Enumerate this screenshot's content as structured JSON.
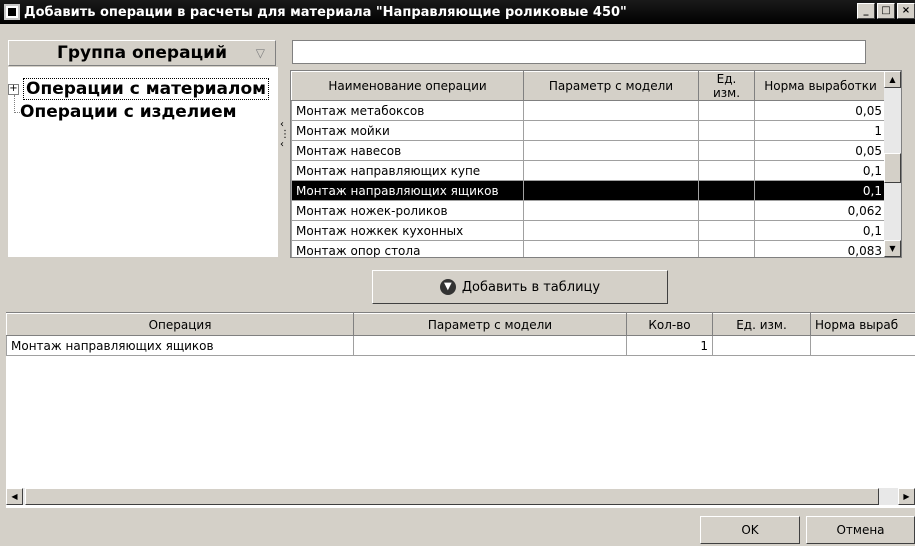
{
  "window": {
    "title": "Добавить операции в расчеты для материала \"Направляющие роликовые 450\"",
    "minimize": "_",
    "maximize": "□",
    "close": "×"
  },
  "groups": {
    "header": "Группа операций",
    "items": [
      {
        "label": "Операции с материалом",
        "expander": "+"
      },
      {
        "label": "Операции с изделием"
      }
    ]
  },
  "search": {
    "value": "",
    "placeholder": ""
  },
  "operations": {
    "columns": [
      "Наименование операции",
      "Параметр с модели",
      "Ед. изм.",
      "Норма выработки"
    ],
    "rows": [
      {
        "name": "Монтаж метабоксов",
        "param": "",
        "unit": "",
        "norm": "0,05"
      },
      {
        "name": "Монтаж мойки",
        "param": "",
        "unit": "",
        "norm": "1"
      },
      {
        "name": "Монтаж навесов",
        "param": "",
        "unit": "",
        "norm": "0,05"
      },
      {
        "name": "Монтаж направляющих купе",
        "param": "",
        "unit": "",
        "norm": "0,1"
      },
      {
        "name": "Монтаж направляющих ящиков",
        "param": "",
        "unit": "",
        "norm": "0,1"
      },
      {
        "name": "Монтаж ножек-роликов",
        "param": "",
        "unit": "",
        "norm": "0,062"
      },
      {
        "name": "Монтаж ножкек кухонных",
        "param": "",
        "unit": "",
        "norm": "0,1"
      },
      {
        "name": "Монтаж опор стола",
        "param": "",
        "unit": "",
        "norm": "0,083"
      }
    ],
    "selected_index": 4
  },
  "add_button": {
    "label": "Добавить в таблицу",
    "icon": "arrow-down-circle-icon"
  },
  "result": {
    "columns": [
      "Операция",
      "Параметр с модели",
      "Кол-во",
      "Ед. изм.",
      "Норма выраб"
    ],
    "rows": [
      {
        "operation": "Монтаж направляющих ящиков",
        "param": "",
        "qty": "1",
        "unit": "",
        "norm": ""
      }
    ]
  },
  "buttons": {
    "ok": "OK",
    "cancel": "Отмена"
  }
}
